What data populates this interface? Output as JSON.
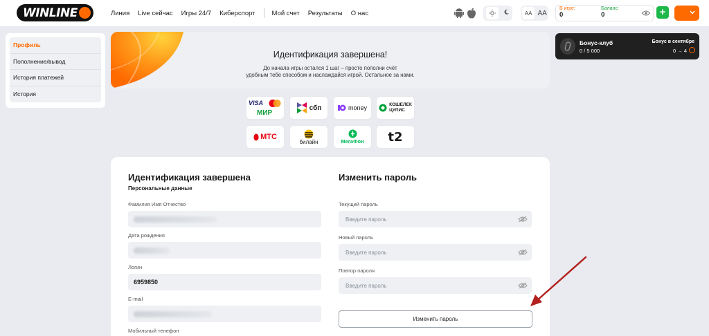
{
  "header": {
    "logo": "WINLINE",
    "nav": [
      "Линия",
      "Live сейчас",
      "Игры 24/7",
      "Киберспорт"
    ],
    "nav2": [
      "Мой счет",
      "Результаты",
      "О нас"
    ],
    "font_small": "AA",
    "font_large": "AA",
    "in_game_label": "В игре:",
    "in_game_value": "0",
    "balance_label": "Баланс:",
    "balance_value": "0",
    "add_funds": "+",
    "icons": [
      "android-icon",
      "apple-icon",
      "sun-icon",
      "moon-icon",
      "eye-icon",
      "chevron-down-icon"
    ]
  },
  "sidebar": {
    "items": [
      {
        "label": "Профиль",
        "active": true
      },
      {
        "label": "Пополнение/вывод",
        "active": false
      },
      {
        "label": "История платежей",
        "active": false
      },
      {
        "label": "История",
        "active": false
      }
    ]
  },
  "banner": {
    "title": "Идентификация завершена!",
    "line1": "До начала игры остался 1 шаг – просто пополни счёт",
    "line2": "удобным тебе способом и наслаждайся игрой. Остальное за нами."
  },
  "bonus": {
    "title": "Бонус-клуб",
    "progress": "0 / 5 000",
    "right_title": "Бонус в сентябре",
    "right_value": "0 → 4"
  },
  "payments": {
    "visa": "VISA",
    "mir": "МИР",
    "sbp": "сбп",
    "yoomoney": "money",
    "cupis_1": "КОШЕЛЕК",
    "cupis_2": "ЦУПИС",
    "mts": "МТС",
    "beeline": "билайн",
    "megafon": "МегаФон",
    "t2": "t2"
  },
  "identity": {
    "title": "Идентификация завершена",
    "subtitle": "Персональные данные",
    "fio_label": "Фамилия Имя Отчество",
    "dob_label": "Дата рождения",
    "login_label": "Логин",
    "login_value": "6959850",
    "email_label": "E-mail",
    "phone_label": "Мобильный телефон"
  },
  "password": {
    "title": "Изменить пароль",
    "current_label": "Текущий пароль",
    "new_label": "Новый пароль",
    "repeat_label": "Повтор пароля",
    "placeholder": "Введите пароль",
    "button": "Изменить пароль"
  },
  "colors": {
    "brand": "#ff6a00",
    "success": "#1db84a",
    "annotation_arrow": "#b3221f"
  }
}
